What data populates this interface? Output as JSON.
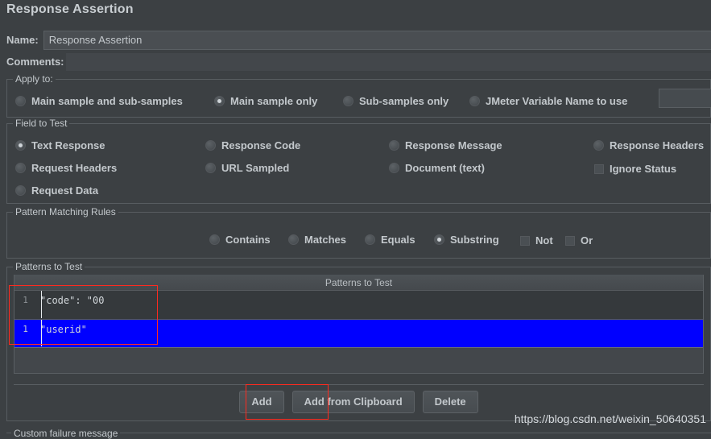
{
  "window": {
    "title": "Response Assertion"
  },
  "fields": {
    "name_label": "Name:",
    "name_value": "Response Assertion",
    "comments_label": "Comments:",
    "comments_value": ""
  },
  "apply_to": {
    "group_title": "Apply to:",
    "options": [
      {
        "label": "Main sample and sub-samples",
        "selected": false
      },
      {
        "label": "Main sample only",
        "selected": true
      },
      {
        "label": "Sub-samples only",
        "selected": false
      },
      {
        "label": "JMeter Variable Name to use",
        "selected": false
      }
    ],
    "variable_value": ""
  },
  "field_to_test": {
    "group_title": "Field to Test",
    "options": [
      {
        "label": "Text Response",
        "selected": true
      },
      {
        "label": "Response Code",
        "selected": false
      },
      {
        "label": "Response Message",
        "selected": false
      },
      {
        "label": "Response Headers",
        "selected": false
      },
      {
        "label": "Request Headers",
        "selected": false
      },
      {
        "label": "URL Sampled",
        "selected": false
      },
      {
        "label": "Document (text)",
        "selected": false
      },
      {
        "label": "Request Data",
        "selected": false
      }
    ],
    "ignore_status": {
      "label": "Ignore Status",
      "checked": false
    }
  },
  "pattern_matching_rules": {
    "group_title": "Pattern Matching Rules",
    "options": [
      {
        "label": "Contains",
        "selected": false
      },
      {
        "label": "Matches",
        "selected": false
      },
      {
        "label": "Equals",
        "selected": false
      },
      {
        "label": "Substring",
        "selected": true
      }
    ],
    "modifiers": [
      {
        "label": "Not",
        "checked": false
      },
      {
        "label": "Or",
        "checked": false
      }
    ]
  },
  "patterns_to_test": {
    "group_title": "Patterns to Test",
    "column_header": "Patterns to Test",
    "rows": [
      {
        "line_number": "1",
        "value": "\"code\": \"00",
        "selected": false
      },
      {
        "line_number": "1",
        "value": "\"userid\"",
        "selected": true
      }
    ],
    "buttons": {
      "add": "Add",
      "add_from_clipboard": "Add from Clipboard",
      "delete": "Delete"
    }
  },
  "custom_failure_message": {
    "group_title": "Custom failure message"
  },
  "watermark": {
    "text": "https://blog.csdn.net/weixin_50640351"
  },
  "colors": {
    "background": "#3c4043",
    "selection_blue": "#0000ff",
    "annotation_red": "#ff2a1e",
    "text": "#c3c8cc"
  }
}
